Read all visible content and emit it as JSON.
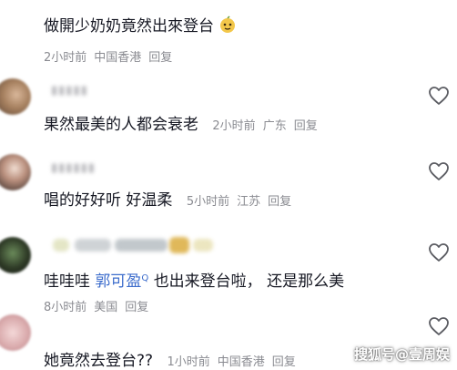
{
  "comments": [
    {
      "text": "做開少奶奶竟然出來登台",
      "time": "2小时前",
      "location": "中国香港",
      "reply": "回复"
    },
    {
      "text": "果然最美的人都会衰老",
      "time": "2小时前",
      "location": "广东",
      "reply": "回复"
    },
    {
      "text": "唱的好好听 好温柔",
      "time": "5小时前",
      "location": "江苏",
      "reply": "回复"
    },
    {
      "text_prefix": "哇哇哇",
      "mention": "郭可盈",
      "text_suffix": "也出来登台啦，  还是那么美",
      "time": "8小时前",
      "location": "美国",
      "reply": "回复"
    },
    {
      "text": "她竟然去登台??",
      "time": "1小时前",
      "location": "中国香港",
      "reply": "回复"
    }
  ],
  "watermark": "搜狐号@壹周娱",
  "icons": {
    "like": "heart-outline-icon",
    "emoji": "face-emoji-icon"
  },
  "colors": {
    "mention": "#3d6dcc",
    "meta": "#8a8b91"
  }
}
